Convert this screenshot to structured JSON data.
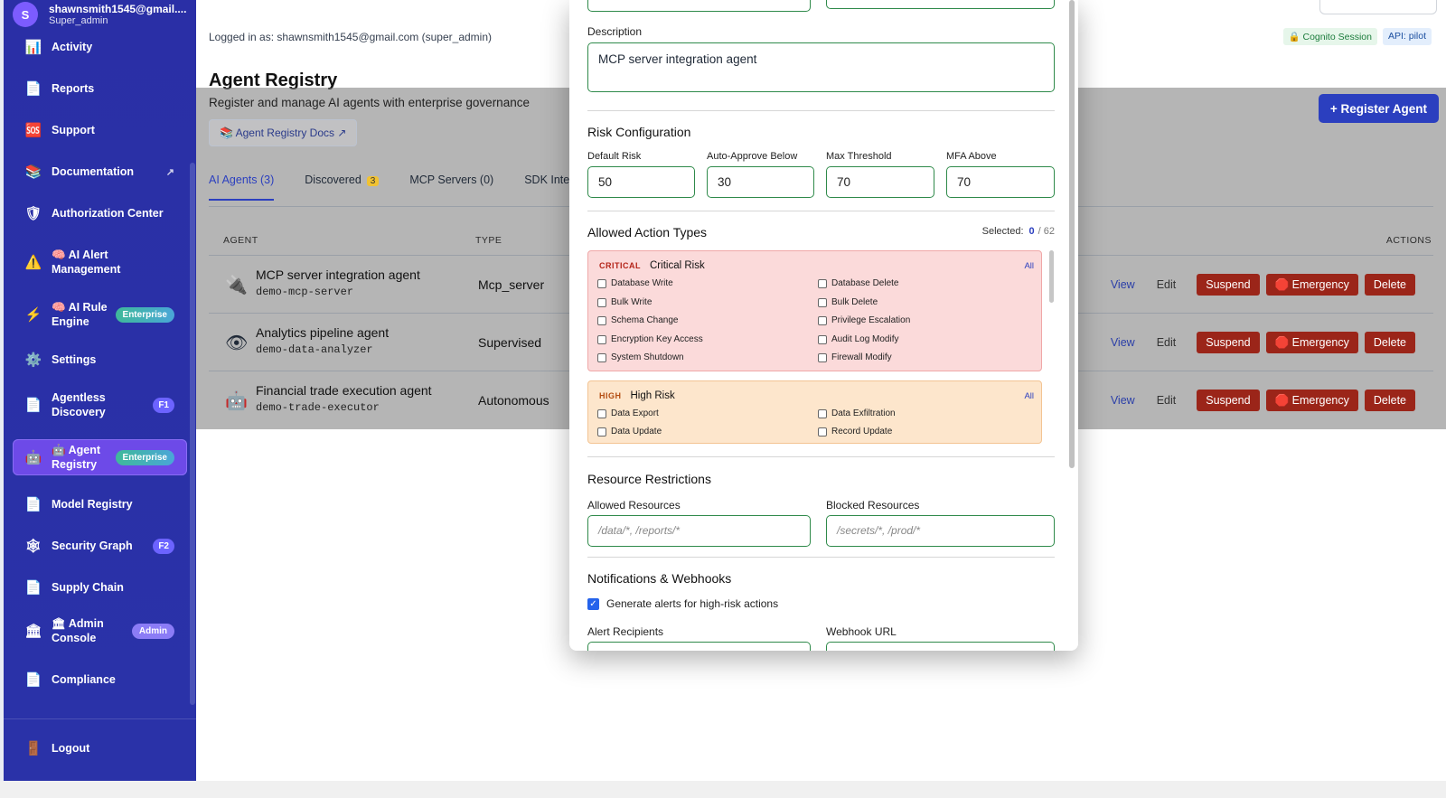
{
  "user": {
    "initial": "S",
    "email": "shawnsmith1545@gmail....",
    "role": "Super_admin"
  },
  "sidebar": {
    "items": [
      {
        "label": "Activity",
        "icon": "📊",
        "icon_name": "chart-icon"
      },
      {
        "label": "Reports",
        "icon": "📄",
        "icon_name": "document-icon"
      },
      {
        "label": "Support",
        "icon": "🆘",
        "icon_name": "sos-icon"
      },
      {
        "label": "Documentation",
        "icon": "📚",
        "icon_name": "books-icon",
        "ext": "↗"
      },
      {
        "label": "Authorization Center",
        "icon": "🛡",
        "icon_name": "shield-icon"
      },
      {
        "label": "🧠 AI Alert Management",
        "icon": "⚠️",
        "icon_name": "warning-icon"
      },
      {
        "label": "🧠 AI Rule Engine",
        "icon": "⚡",
        "icon_name": "lightning-icon",
        "badge": "Enterprise"
      },
      {
        "label": "Settings",
        "icon": "⚙️",
        "icon_name": "gear-icon"
      },
      {
        "label": "Agentless Discovery",
        "icon": "📄",
        "icon_name": "document-icon",
        "badge": "F1"
      },
      {
        "label": "🤖 Agent Registry",
        "icon": "🤖",
        "icon_name": "robot-icon",
        "badge": "Enterprise"
      },
      {
        "label": "Model Registry",
        "icon": "📄",
        "icon_name": "document-icon"
      },
      {
        "label": "Security Graph",
        "icon": "🕸",
        "icon_name": "graph-icon",
        "badge": "F2"
      },
      {
        "label": "Supply Chain",
        "icon": "📄",
        "icon_name": "document-icon"
      },
      {
        "label": "🏛 Admin Console",
        "icon": "🏛",
        "icon_name": "building-icon",
        "badge": "Admin"
      },
      {
        "label": "Compliance",
        "icon": "📄",
        "icon_name": "document-icon"
      }
    ],
    "logout": {
      "label": "Logout",
      "icon": "🚪"
    }
  },
  "header": {
    "logged_in": "Logged in as: shawnsmith1545@gmail.com (super_admin)",
    "cognito": "🔒 Cognito Session",
    "api": "API: pilot"
  },
  "page": {
    "title": "Agent Registry",
    "subtitle": "Register and manage AI agents with enterprise governance",
    "docs_button": "📚 Agent Registry Docs ↗",
    "register_button": "+ Register Agent",
    "tabs": [
      {
        "label": "AI Agents (3)"
      },
      {
        "label": "Discovered",
        "count": "3"
      },
      {
        "label": "MCP Servers (0)"
      },
      {
        "label": "SDK Inte"
      }
    ],
    "columns": {
      "agent": "AGENT",
      "type": "TYPE",
      "actions": "ACTIONS"
    },
    "agents": [
      {
        "icon": "🔌",
        "name": "MCP server integration agent",
        "id": "demo-mcp-server",
        "type": "Mcp_server"
      },
      {
        "icon": "👁",
        "name": "Analytics pipeline agent",
        "id": "demo-data-analyzer",
        "type": "Supervised"
      },
      {
        "icon": "🤖",
        "name": "Financial trade execution agent",
        "id": "demo-trade-executor",
        "type": "Autonomous"
      }
    ],
    "row_actions": {
      "view": "View",
      "edit": "Edit",
      "suspend": "Suspend",
      "emergency": "🛑 Emergency",
      "delete": "Delete"
    }
  },
  "modal": {
    "description_label": "Description",
    "description_value": "MCP server integration agent",
    "risk_config_title": "Risk Configuration",
    "risk_fields": [
      {
        "label": "Default Risk",
        "value": "50"
      },
      {
        "label": "Auto-Approve Below",
        "value": "30"
      },
      {
        "label": "Max Threshold",
        "value": "70"
      },
      {
        "label": "MFA Above",
        "value": "70"
      }
    ],
    "allowed_actions_title": "Allowed Action Types",
    "selected_label": "Selected:",
    "selected_count": "0",
    "selected_total": "/ 62",
    "critical": {
      "tag": "CRITICAL",
      "title": "Critical Risk",
      "all": "All",
      "left": [
        "Database Write",
        "Bulk Write",
        "Schema Change",
        "Encryption Key Access",
        "System Shutdown"
      ],
      "right": [
        "Database Delete",
        "Bulk Delete",
        "Privilege Escalation",
        "Audit Log Modify",
        "Firewall Modify"
      ]
    },
    "high": {
      "tag": "HIGH",
      "title": "High Risk",
      "all": "All",
      "left": [
        "Data Export",
        "Data Update"
      ],
      "right": [
        "Data Exfiltration",
        "Record Update"
      ]
    },
    "resource_title": "Resource Restrictions",
    "allowed_resources_label": "Allowed Resources",
    "allowed_resources_placeholder": "/data/*, /reports/*",
    "blocked_resources_label": "Blocked Resources",
    "blocked_resources_placeholder": "/secrets/*, /prod/*",
    "notif_title": "Notifications & Webhooks",
    "alerts_checkbox": "Generate alerts for high-risk actions",
    "alert_recipients_label": "Alert Recipients",
    "webhook_label": "Webhook URL"
  }
}
